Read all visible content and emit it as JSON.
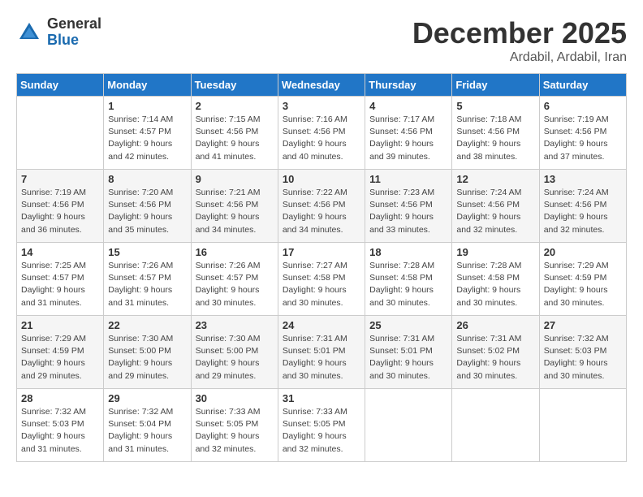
{
  "logo": {
    "general": "General",
    "blue": "Blue"
  },
  "title": "December 2025",
  "location": "Ardabil, Ardabil, Iran",
  "days_of_week": [
    "Sunday",
    "Monday",
    "Tuesday",
    "Wednesday",
    "Thursday",
    "Friday",
    "Saturday"
  ],
  "weeks": [
    [
      {
        "day": "",
        "info": ""
      },
      {
        "day": "1",
        "info": "Sunrise: 7:14 AM\nSunset: 4:57 PM\nDaylight: 9 hours\nand 42 minutes."
      },
      {
        "day": "2",
        "info": "Sunrise: 7:15 AM\nSunset: 4:56 PM\nDaylight: 9 hours\nand 41 minutes."
      },
      {
        "day": "3",
        "info": "Sunrise: 7:16 AM\nSunset: 4:56 PM\nDaylight: 9 hours\nand 40 minutes."
      },
      {
        "day": "4",
        "info": "Sunrise: 7:17 AM\nSunset: 4:56 PM\nDaylight: 9 hours\nand 39 minutes."
      },
      {
        "day": "5",
        "info": "Sunrise: 7:18 AM\nSunset: 4:56 PM\nDaylight: 9 hours\nand 38 minutes."
      },
      {
        "day": "6",
        "info": "Sunrise: 7:19 AM\nSunset: 4:56 PM\nDaylight: 9 hours\nand 37 minutes."
      }
    ],
    [
      {
        "day": "7",
        "info": "Sunrise: 7:19 AM\nSunset: 4:56 PM\nDaylight: 9 hours\nand 36 minutes."
      },
      {
        "day": "8",
        "info": "Sunrise: 7:20 AM\nSunset: 4:56 PM\nDaylight: 9 hours\nand 35 minutes."
      },
      {
        "day": "9",
        "info": "Sunrise: 7:21 AM\nSunset: 4:56 PM\nDaylight: 9 hours\nand 34 minutes."
      },
      {
        "day": "10",
        "info": "Sunrise: 7:22 AM\nSunset: 4:56 PM\nDaylight: 9 hours\nand 34 minutes."
      },
      {
        "day": "11",
        "info": "Sunrise: 7:23 AM\nSunset: 4:56 PM\nDaylight: 9 hours\nand 33 minutes."
      },
      {
        "day": "12",
        "info": "Sunrise: 7:24 AM\nSunset: 4:56 PM\nDaylight: 9 hours\nand 32 minutes."
      },
      {
        "day": "13",
        "info": "Sunrise: 7:24 AM\nSunset: 4:56 PM\nDaylight: 9 hours\nand 32 minutes."
      }
    ],
    [
      {
        "day": "14",
        "info": "Sunrise: 7:25 AM\nSunset: 4:57 PM\nDaylight: 9 hours\nand 31 minutes."
      },
      {
        "day": "15",
        "info": "Sunrise: 7:26 AM\nSunset: 4:57 PM\nDaylight: 9 hours\nand 31 minutes."
      },
      {
        "day": "16",
        "info": "Sunrise: 7:26 AM\nSunset: 4:57 PM\nDaylight: 9 hours\nand 30 minutes."
      },
      {
        "day": "17",
        "info": "Sunrise: 7:27 AM\nSunset: 4:58 PM\nDaylight: 9 hours\nand 30 minutes."
      },
      {
        "day": "18",
        "info": "Sunrise: 7:28 AM\nSunset: 4:58 PM\nDaylight: 9 hours\nand 30 minutes."
      },
      {
        "day": "19",
        "info": "Sunrise: 7:28 AM\nSunset: 4:58 PM\nDaylight: 9 hours\nand 30 minutes."
      },
      {
        "day": "20",
        "info": "Sunrise: 7:29 AM\nSunset: 4:59 PM\nDaylight: 9 hours\nand 30 minutes."
      }
    ],
    [
      {
        "day": "21",
        "info": "Sunrise: 7:29 AM\nSunset: 4:59 PM\nDaylight: 9 hours\nand 29 minutes."
      },
      {
        "day": "22",
        "info": "Sunrise: 7:30 AM\nSunset: 5:00 PM\nDaylight: 9 hours\nand 29 minutes."
      },
      {
        "day": "23",
        "info": "Sunrise: 7:30 AM\nSunset: 5:00 PM\nDaylight: 9 hours\nand 29 minutes."
      },
      {
        "day": "24",
        "info": "Sunrise: 7:31 AM\nSunset: 5:01 PM\nDaylight: 9 hours\nand 30 minutes."
      },
      {
        "day": "25",
        "info": "Sunrise: 7:31 AM\nSunset: 5:01 PM\nDaylight: 9 hours\nand 30 minutes."
      },
      {
        "day": "26",
        "info": "Sunrise: 7:31 AM\nSunset: 5:02 PM\nDaylight: 9 hours\nand 30 minutes."
      },
      {
        "day": "27",
        "info": "Sunrise: 7:32 AM\nSunset: 5:03 PM\nDaylight: 9 hours\nand 30 minutes."
      }
    ],
    [
      {
        "day": "28",
        "info": "Sunrise: 7:32 AM\nSunset: 5:03 PM\nDaylight: 9 hours\nand 31 minutes."
      },
      {
        "day": "29",
        "info": "Sunrise: 7:32 AM\nSunset: 5:04 PM\nDaylight: 9 hours\nand 31 minutes."
      },
      {
        "day": "30",
        "info": "Sunrise: 7:33 AM\nSunset: 5:05 PM\nDaylight: 9 hours\nand 32 minutes."
      },
      {
        "day": "31",
        "info": "Sunrise: 7:33 AM\nSunset: 5:05 PM\nDaylight: 9 hours\nand 32 minutes."
      },
      {
        "day": "",
        "info": ""
      },
      {
        "day": "",
        "info": ""
      },
      {
        "day": "",
        "info": ""
      }
    ]
  ]
}
